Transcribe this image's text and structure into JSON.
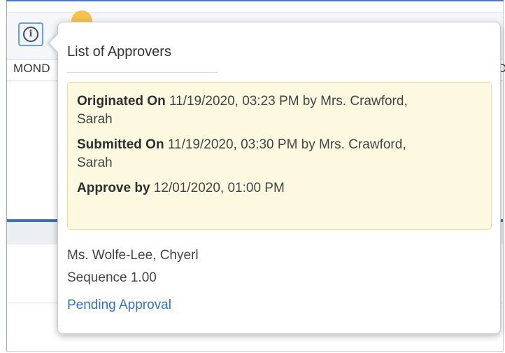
{
  "page": {
    "column_left": "MOND",
    "column_right": "D"
  },
  "popover": {
    "title": "List of Approvers",
    "originated": {
      "label": "Originated On",
      "value": " 11/19/2020, 03:23 PM by Mrs. Crawford, Sarah"
    },
    "submitted": {
      "label": "Submitted On",
      "value": " 11/19/2020, 03:30 PM by Mrs. Crawford, Sarah"
    },
    "approve_by": {
      "label": "Approve by",
      "value": " 12/01/2020, 01:00 PM"
    },
    "approver": {
      "name": "Ms. Wolfe-Lee, Chyerl",
      "sequence": "Sequence 1.00",
      "status": "Pending Approval"
    }
  },
  "icons": {
    "info_button": "info-icon",
    "info_glyph": "i"
  },
  "colors": {
    "accent_blue": "#3b6fc2",
    "link_blue": "#2f72c8",
    "notice_bg": "#fdf9e1",
    "badge_yellow": "#f5c24a"
  }
}
